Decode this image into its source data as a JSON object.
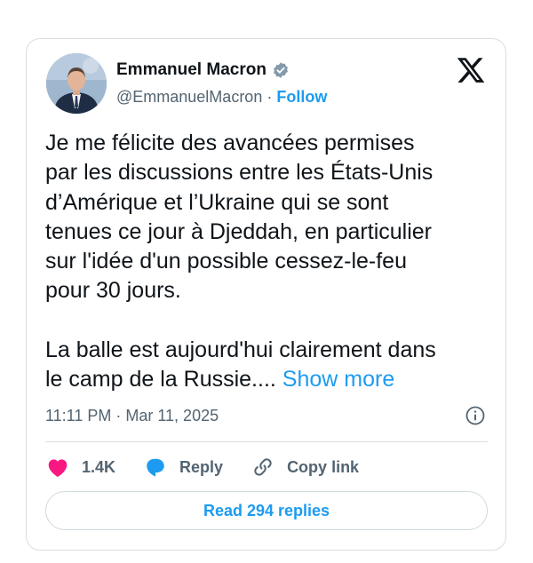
{
  "author": {
    "name": "Emmanuel Macron",
    "handle": "@EmmanuelMacron",
    "separator": "·",
    "follow_label": "Follow"
  },
  "tweet": {
    "paragraph1": "Je me félicite des avancées permises\npar les discussions entre les États-Unis\nd’Amérique et l’Ukraine qui se sont\ntenues ce jour à Djeddah, en particulier\nsur l'idée d'un possible cessez-le-feu\npour 30 jours.",
    "paragraph2": "La balle est aujourd'hui clairement dans\nle camp de la Russie.... ",
    "show_more": "Show more",
    "timestamp": "11:11 PM · Mar 11, 2025"
  },
  "actions": {
    "likes": "1.4K",
    "reply_label": "Reply",
    "copy_link_label": "Copy link"
  },
  "replies_button": "Read 294 replies",
  "colors": {
    "accent": "#1d9bf0",
    "like": "#f91880",
    "verified": "#829aab",
    "text": "#0f1419",
    "secondary": "#536471"
  },
  "icons": [
    "verified-badge-icon",
    "x-logo-icon",
    "info-icon",
    "heart-icon",
    "reply-bubble-icon",
    "link-icon"
  ]
}
